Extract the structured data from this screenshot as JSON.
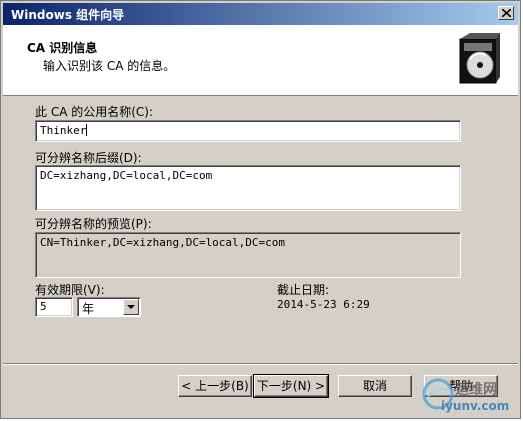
{
  "window": {
    "title": "Windows 组件向导",
    "close_label": "×"
  },
  "header": {
    "title": "CA 识别信息",
    "subtitle": "输入识别该 CA 的信息。"
  },
  "form": {
    "common_name_label": "此 CA 的公用名称(C):",
    "common_name_value": "Thinker",
    "dn_suffix_label": "可分辨名称后缀(D):",
    "dn_suffix_value": "DC=xizhang,DC=local,DC=com",
    "dn_preview_label": "可分辨名称的预览(P):",
    "dn_preview_value": "CN=Thinker,DC=xizhang,DC=local,DC=com",
    "validity_label": "有效期限(V):",
    "validity_value": "5",
    "validity_unit": "年",
    "expiry_label": "截止日期:",
    "expiry_value": "2014-5-23 6:29"
  },
  "buttons": {
    "back": "< 上一步(B)",
    "next": "下一步(N) >",
    "cancel": "取消",
    "help": "帮助"
  },
  "watermark": {
    "line1": "运维网",
    "line2": "iyunv.com"
  }
}
